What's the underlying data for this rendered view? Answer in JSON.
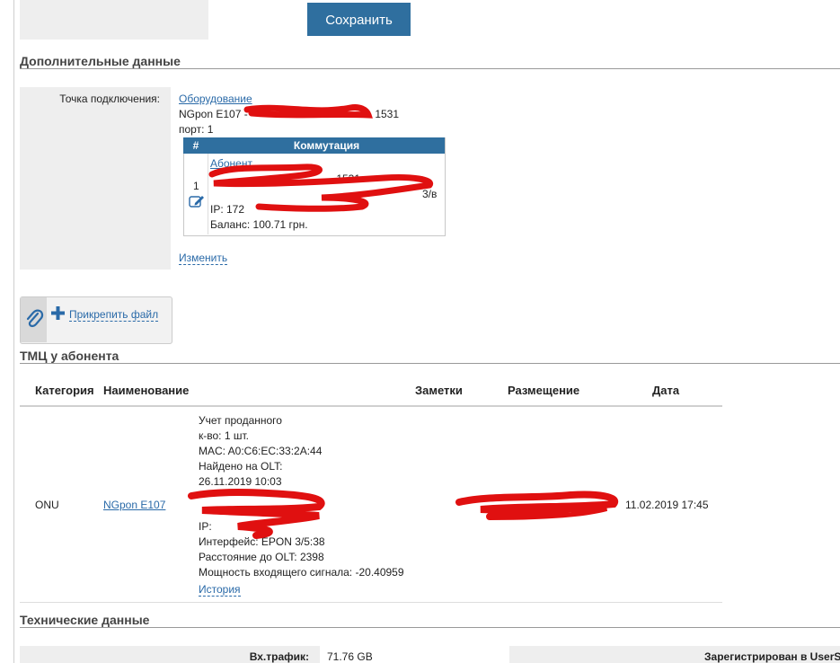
{
  "toolbar": {
    "save_label": "Сохранить"
  },
  "extra_section": {
    "title": "Дополнительные данные"
  },
  "connection": {
    "label": "Точка подключения:",
    "equipment_link": "Оборудование",
    "device_prefix": "NGpon E107 -",
    "device_suffix": "- 1531",
    "port": "порт: 1",
    "commutation": {
      "col_num": "#",
      "col_title": "Коммутация",
      "row_num": "1",
      "subscriber_link": "Абонент",
      "line2_suffix": "- 1531",
      "line3_suffix": "3/в",
      "ip_prefix": "IP: 172",
      "balance": "Баланс: 100.71 грн."
    },
    "change_link": "Изменить"
  },
  "attach": {
    "label": "Прикрепить файл",
    "icon": "paperclip-icon",
    "plus_icon": "plus-icon"
  },
  "tmc_section": {
    "title": "ТМЦ у абонента"
  },
  "tmc_table": {
    "headers": {
      "category": "Категория",
      "name": "Наименование",
      "notes": "Заметки",
      "placement": "Размещение",
      "date": "Дата"
    },
    "row": {
      "category": "ONU",
      "name": "NGpon E107",
      "details": [
        "Учет проданного",
        "к-во: 1 шт.",
        "MAC: A0:C6:EC:33:2A:44",
        "Найдено на OLT:",
        "26.11.2019 10:03",
        "",
        "",
        "IP:",
        "Интерфейс: EPON 3/5:38",
        "Расстояние до OLT: 2398",
        "Мощность входящего сигнала: -20.40959"
      ],
      "history_link": "История",
      "date": "11.02.2019 17:45"
    }
  },
  "tech_section": {
    "title": "Технические данные"
  },
  "tech": {
    "in_traffic_label": "Вх.трафик:",
    "in_traffic_value": "71.76 GB",
    "registered_label": "Зарегистрирован в UserSi"
  },
  "colors": {
    "accent": "#2f6f9f",
    "link": "#2a6aa8",
    "redaction": "#e01010"
  }
}
